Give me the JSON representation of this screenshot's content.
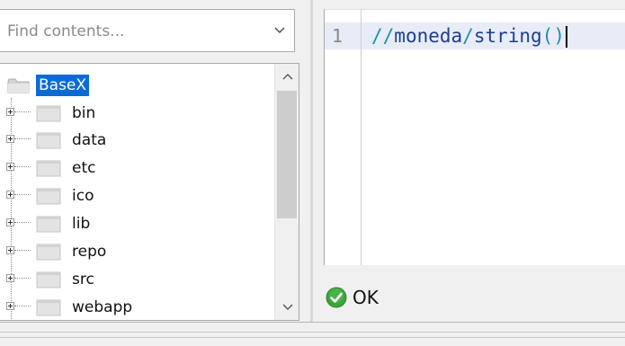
{
  "search": {
    "placeholder": "Find contents...",
    "value": ""
  },
  "tree": {
    "root": {
      "label": "BaseX",
      "selected": true
    },
    "items": [
      {
        "label": "bin"
      },
      {
        "label": "data"
      },
      {
        "label": "etc"
      },
      {
        "label": "ico"
      },
      {
        "label": "lib"
      },
      {
        "label": "repo"
      },
      {
        "label": "src"
      },
      {
        "label": "webapp"
      }
    ]
  },
  "editor": {
    "line_number": "1",
    "tokens": {
      "slashes1": "//",
      "moneda": "moneda",
      "slash2": "/",
      "string": "string",
      "parens": "()"
    }
  },
  "status": {
    "text": "OK",
    "icon": "check-circle-icon"
  },
  "colors": {
    "selection": "#0a6bd6",
    "current_line": "#e8ecf7",
    "ok_green": "#3aa53a"
  }
}
